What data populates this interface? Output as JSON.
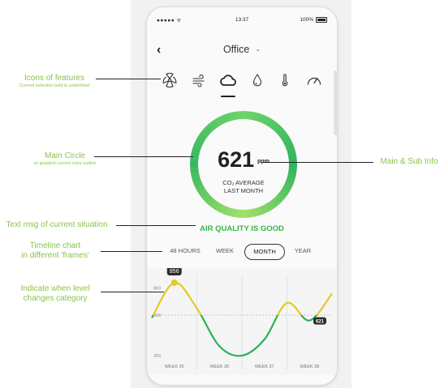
{
  "status_bar": {
    "signal": "●●●●● ᯤ",
    "time": "13:37",
    "battery": "100%"
  },
  "header": {
    "back": "‹",
    "location": "Office",
    "chevron": "⌄"
  },
  "features": [
    {
      "icon": "radiation-icon",
      "selected": false
    },
    {
      "icon": "wind-icon",
      "selected": false
    },
    {
      "icon": "cloud-icon",
      "selected": true
    },
    {
      "icon": "droplet-icon",
      "selected": false
    },
    {
      "icon": "thermometer-icon",
      "selected": false
    },
    {
      "icon": "gauge-icon",
      "selected": false
    }
  ],
  "main": {
    "value": "621",
    "unit": "ppm",
    "sub_line1": "CO₂ AVERAGE",
    "sub_line2": "LAST MONTH",
    "status": "AIR QUALITY IS GOOD"
  },
  "frames": {
    "h48": "48 HOURS",
    "week": "WEEK",
    "month": "MONTH",
    "year": "YEAR",
    "selected": "MONTH"
  },
  "chart_data": {
    "type": "line",
    "categories": [
      "WEEK 35",
      "WEEK 36",
      "WEEK 37",
      "WEEK 38"
    ],
    "y_ticks": [
      "800",
      "600",
      "300"
    ],
    "ylim": [
      300,
      900
    ],
    "threshold": 600,
    "peak_label": "856",
    "end_label": "621",
    "series": [
      {
        "values": [
          580,
          840,
          650,
          370,
          300,
          420,
          690,
          560,
          760
        ]
      }
    ],
    "colors": {
      "good": "#2bb25a",
      "moderate": "#e5c82a"
    }
  },
  "annotations": {
    "icons_title": "Icons of features",
    "icons_sub": "Current selection bold & underlined",
    "circle_title": "Main Circle",
    "circle_sub": "w/ gradient current color outline",
    "main_sub": "Main & Sub Info",
    "text_msg": "Text msg of current situation",
    "timeline_1": "Timeline chart",
    "timeline_2": "in different 'frames'",
    "level_1": "Indicate when level",
    "level_2": "changes category"
  }
}
